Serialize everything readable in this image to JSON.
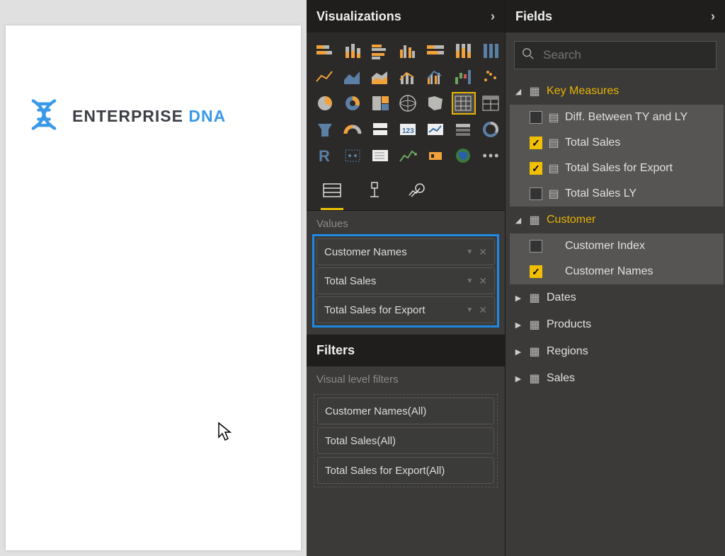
{
  "canvas": {
    "logo_enterprise": "ENTERPRISE",
    "logo_dna": " DNA"
  },
  "visualizations": {
    "title": "Visualizations",
    "values_label": "Values",
    "value_items": [
      {
        "label": "Customer Names"
      },
      {
        "label": "Total Sales"
      },
      {
        "label": "Total Sales for Export"
      }
    ],
    "filters_title": "Filters",
    "visual_filters_label": "Visual level filters",
    "filter_items": [
      {
        "label": "Customer Names(All)"
      },
      {
        "label": "Total Sales(All)"
      },
      {
        "label": "Total Sales for Export(All)"
      }
    ]
  },
  "fields": {
    "title": "Fields",
    "search_placeholder": "Search",
    "tables": {
      "key_measures": {
        "label": "Key Measures",
        "fields": [
          {
            "label": "Diff. Between TY and LY",
            "checked": false
          },
          {
            "label": "Total Sales",
            "checked": true
          },
          {
            "label": "Total Sales for Export",
            "checked": true
          },
          {
            "label": "Total Sales LY",
            "checked": false
          }
        ]
      },
      "customer": {
        "label": "Customer",
        "fields": [
          {
            "label": "Customer Index",
            "checked": false
          },
          {
            "label": "Customer Names",
            "checked": true
          }
        ]
      },
      "collapsed": [
        {
          "label": "Dates"
        },
        {
          "label": "Products"
        },
        {
          "label": "Regions"
        },
        {
          "label": "Sales"
        }
      ]
    }
  }
}
